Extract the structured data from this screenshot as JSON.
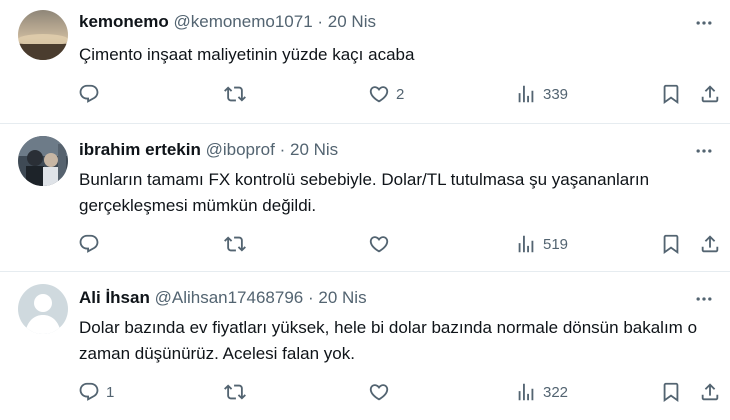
{
  "colors": {
    "text": "#0f1419",
    "muted": "#536471",
    "divider": "#e6ecf0"
  },
  "icons": {
    "reply": "reply-icon",
    "retweet": "retweet-icon",
    "like": "like-icon",
    "views": "views-icon",
    "bookmark": "bookmark-icon",
    "share": "share-icon",
    "more": "more-icon"
  },
  "tweets": [
    {
      "name": "kemonemo",
      "handle": "@kemonemo1071",
      "sep": "·",
      "date": "20 Nis",
      "text": "Çimento inşaat maliyetinin yüzde kaçı acaba",
      "replies": "",
      "retweets": "",
      "likes": "2",
      "views": "339"
    },
    {
      "name": "ibrahim ertekin",
      "handle": "@iboprof",
      "sep": "·",
      "date": "20 Nis",
      "text": "Bunların tamamı FX kontrolü sebebiyle. Dolar/TL tutulmasa şu yaşananların gerçekleşmesi mümkün değildi.",
      "replies": "",
      "retweets": "",
      "likes": "",
      "views": "519"
    },
    {
      "name": "Ali İhsan",
      "handle": "@Alihsan17468796",
      "sep": "·",
      "date": "20 Nis",
      "text": "Dolar bazında ev fiyatları yüksek, hele bi dolar bazında normale dönsün bakalım o zaman düşünürüz. Acelesi falan yok.",
      "replies": "1",
      "retweets": "",
      "likes": "",
      "views": "322"
    }
  ]
}
